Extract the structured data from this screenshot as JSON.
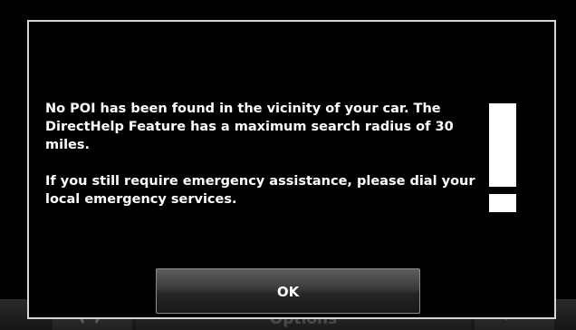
{
  "dialog": {
    "message_paragraph_1": "No POI has been found in the vicinity of your car. The DirectHelp Feature has a maximum search radius of 30 miles.",
    "message_paragraph_2": "If you still require emergency assistance, please dial your local emergency services.",
    "ok_label": "OK",
    "icon": "exclamation-icon"
  },
  "underlying_bar": {
    "options_label": "Options",
    "left_icon": "reload-icon",
    "right_icon": "edit-icon"
  },
  "colors": {
    "background": "#000000",
    "dialog_border": "#d6d6d6",
    "text": "#ffffff"
  }
}
